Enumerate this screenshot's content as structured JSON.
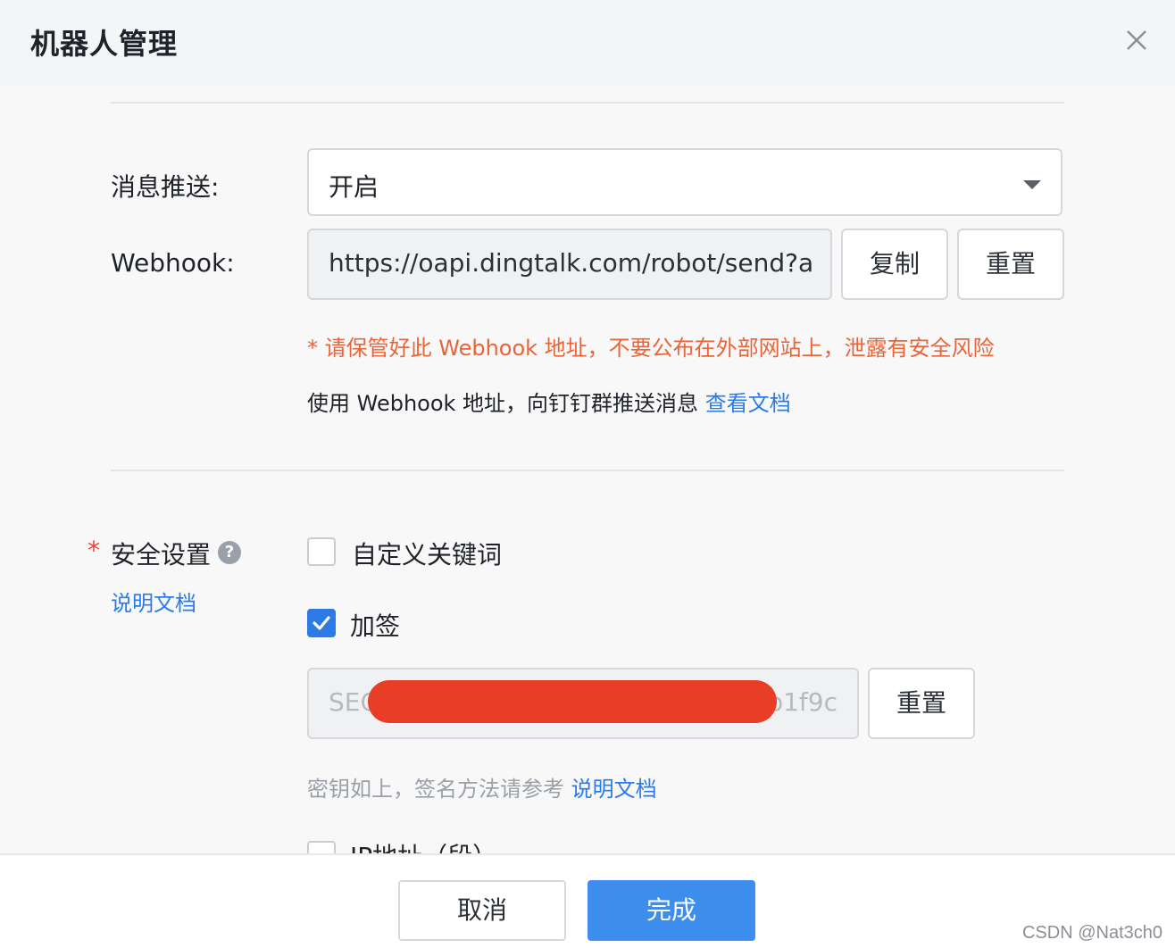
{
  "dialog": {
    "title": "机器人管理"
  },
  "push": {
    "label": "消息推送:",
    "selected": "开启"
  },
  "webhook": {
    "label": "Webhook:",
    "value": "https://oapi.dingtalk.com/robot/send?acc",
    "copy_label": "复制",
    "reset_label": "重置",
    "warning": "* 请保管好此 Webhook 地址，不要公布在外部网站上，泄露有安全风险",
    "info_text": "使用 Webhook 地址，向钉钉群推送消息",
    "info_link": "查看文档"
  },
  "security": {
    "required_mark": "*",
    "label": "安全设置",
    "help_glyph": "?",
    "doc_link": "说明文档",
    "options": [
      {
        "label": "自定义关键词",
        "checked": false
      },
      {
        "label": "加签",
        "checked": true
      },
      {
        "label": "IP地址（段）",
        "checked": false
      }
    ],
    "secret_prefix": "SEC",
    "secret_suffix": "db1f9c",
    "secret_reset_label": "重置",
    "hint_text": "密钥如上，签名方法请参考",
    "hint_link": "说明文档"
  },
  "footer": {
    "cancel_label": "取消",
    "done_label": "完成",
    "watermark": "CSDN @Nat3ch0"
  },
  "colors": {
    "accent": "#3d8ded",
    "link": "#2c7be5",
    "warning": "#e8653a",
    "required": "#e8453c",
    "redaction": "#e83d26"
  }
}
